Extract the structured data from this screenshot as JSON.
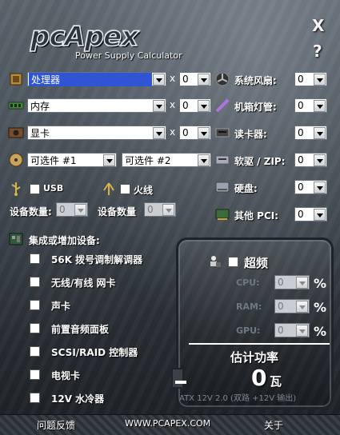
{
  "header": {
    "logo": "pcApex",
    "subtitle": "Power Supply Calculator",
    "close_label": "X",
    "help_label": "?"
  },
  "left": {
    "cpu": {
      "icon": "cpu-icon",
      "value": "处理器",
      "times": "x",
      "qty": "0"
    },
    "memory": {
      "icon": "memory-icon",
      "value": "内存",
      "times": "x",
      "qty": "0"
    },
    "video": {
      "icon": "video-card-icon",
      "value": "显卡",
      "times": "x",
      "qty": "0"
    },
    "optional": {
      "icon": "disc-drive-icon",
      "value1": "可选件 #1",
      "value2": "可选件 #2"
    },
    "usb": {
      "icon": "usb-icon",
      "label": "USB",
      "count_label": "设备数量:",
      "count": "0"
    },
    "firewire": {
      "icon": "firewire-icon",
      "label": "火线",
      "count_label": "设备数量",
      "count": "0"
    }
  },
  "right": {
    "items": [
      {
        "icon": "fan-icon",
        "label": "系统风扇:",
        "value": "0"
      },
      {
        "icon": "case-light-icon",
        "label": "机箱灯管:",
        "value": "0"
      },
      {
        "icon": "card-reader-icon",
        "label": "读卡器:",
        "value": "0"
      },
      {
        "icon": "floppy-zip-icon",
        "label": "软驱 / ZIP:",
        "value": "0"
      },
      {
        "icon": "hard-disk-icon",
        "label": "硬盘:",
        "value": "0"
      },
      {
        "icon": "pci-card-icon",
        "label": "其他 PCI:",
        "value": "0"
      }
    ]
  },
  "integrated": {
    "title": "集成或增加设备:",
    "items": [
      {
        "label": "56K 拨号调制解调器"
      },
      {
        "label": "无线/有线 网卡"
      },
      {
        "label": "声卡"
      },
      {
        "label": "前置音频面板"
      },
      {
        "label": "SCSI/RAID 控制器"
      },
      {
        "label": "电视卡"
      },
      {
        "label": "12V 水冷器"
      }
    ]
  },
  "overclock": {
    "label": "超频",
    "fields": [
      {
        "label": "CPU:",
        "value": "0",
        "unit": "%"
      },
      {
        "label": "RAM:",
        "value": "0",
        "unit": "%"
      },
      {
        "label": "GPU:",
        "value": "0",
        "unit": "%"
      }
    ],
    "estimate_label": "估计功率",
    "watts": "0",
    "watts_unit": "瓦",
    "atx_note": "ATX 12V 2.0 (双路 +12V 输出)"
  },
  "footer": {
    "feedback": "问题反馈",
    "website": "WWW.PCAPEX.COM",
    "about": "关于"
  },
  "colors": {
    "selection": "#2f55d4",
    "background": "#3d454d"
  }
}
